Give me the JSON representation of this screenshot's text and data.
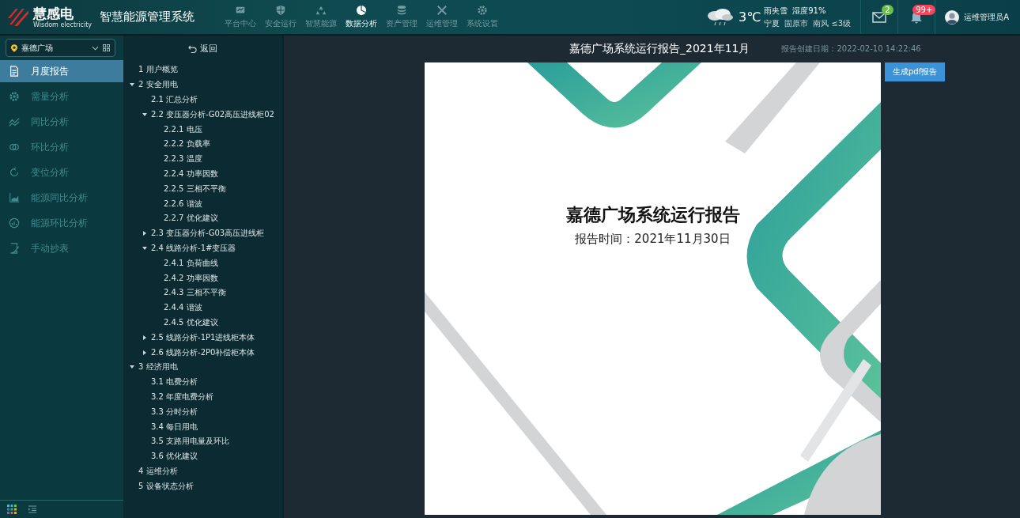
{
  "header": {
    "brand": "慧感电",
    "brand_sub": "Wisdom electricity",
    "title": "智慧能源管理系统",
    "nav": [
      {
        "label": "平台中心",
        "selected": false
      },
      {
        "label": "安全运行",
        "selected": false
      },
      {
        "label": "智慧能源",
        "selected": false
      },
      {
        "label": "数据分析",
        "selected": true
      },
      {
        "label": "资产管理",
        "selected": false
      },
      {
        "label": "运维管理",
        "selected": false
      },
      {
        "label": "系统设置",
        "selected": false
      }
    ],
    "weather": {
      "temperature": "3℃",
      "condition": "雨夹雪",
      "humidity": "湿度91%",
      "location": "宁夏",
      "city": "固原市",
      "wind": "南风 ≤3级"
    },
    "messages_badge": "2",
    "notifications_badge": "99+",
    "user": "运维管理员A"
  },
  "sidebar": {
    "site": "嘉德广场",
    "menu": [
      {
        "label": "月度报告",
        "selected": true
      },
      {
        "label": "需量分析",
        "selected": false
      },
      {
        "label": "同比分析",
        "selected": false
      },
      {
        "label": "环比分析",
        "selected": false
      },
      {
        "label": "变位分析",
        "selected": false
      },
      {
        "label": "能源同比分析",
        "selected": false
      },
      {
        "label": "能源环比分析",
        "selected": false
      },
      {
        "label": "手动抄表",
        "selected": false
      }
    ]
  },
  "outline": {
    "back": "返回",
    "items": [
      {
        "label": "1 用户概览"
      },
      {
        "label": "2 安全用电",
        "expanded": true,
        "children": [
          {
            "label": "2.1 汇总分析"
          },
          {
            "label": "2.2 变压器分析-G02高压进线柜02",
            "expanded": true,
            "children": [
              {
                "label": "2.2.1 电压"
              },
              {
                "label": "2.2.2 负载率"
              },
              {
                "label": "2.2.3 温度"
              },
              {
                "label": "2.2.4 功率因数"
              },
              {
                "label": "2.2.5 三相不平衡"
              },
              {
                "label": "2.2.6 谐波"
              },
              {
                "label": "2.2.7 优化建议"
              }
            ]
          },
          {
            "label": "2.3 变压器分析-G03高压进线柜",
            "expanded": false
          },
          {
            "label": "2.4 线路分析-1#变压器",
            "expanded": true,
            "children": [
              {
                "label": "2.4.1 负荷曲线"
              },
              {
                "label": "2.4.2 功率因数"
              },
              {
                "label": "2.4.3 三相不平衡"
              },
              {
                "label": "2.4.4 谐波"
              },
              {
                "label": "2.4.5 优化建议"
              }
            ]
          },
          {
            "label": "2.5 线路分析-1P1进线柜本体",
            "expanded": false
          },
          {
            "label": "2.6 线路分析-2P0补偿柜本体",
            "expanded": false
          }
        ]
      },
      {
        "label": "3 经济用电",
        "expanded": true,
        "children": [
          {
            "label": "3.1 电费分析"
          },
          {
            "label": "3.2 年度电费分析"
          },
          {
            "label": "3.3 分时分析"
          },
          {
            "label": "3.4 每日用电"
          },
          {
            "label": "3.5 支路用电量及环比"
          },
          {
            "label": "3.6 优化建议"
          }
        ]
      },
      {
        "label": "4 运维分析"
      },
      {
        "label": "5 设备状态分析"
      }
    ]
  },
  "report": {
    "title": "嘉德广场系统运行报告_2021年11月",
    "created": "报告创建日期：2022-02-10 14:22:46",
    "export_button": "生成pdf报告",
    "cover": {
      "title": "嘉德广场系统运行报告",
      "subtitle": "报告时间：2021年11月30日"
    }
  }
}
